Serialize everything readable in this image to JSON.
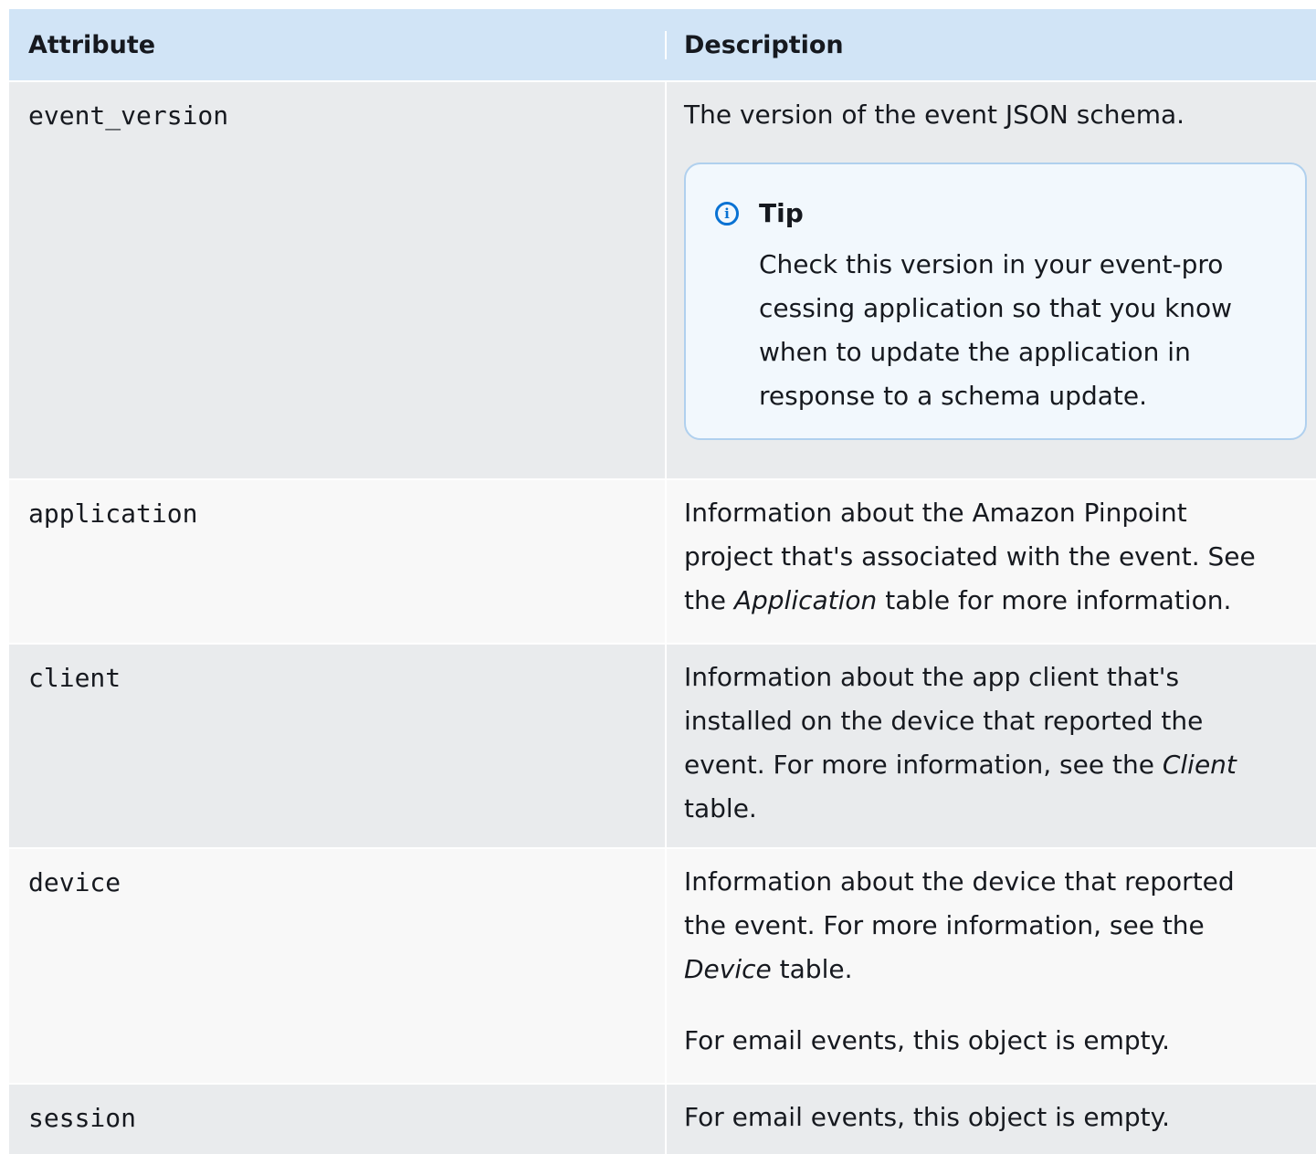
{
  "table": {
    "header": {
      "attribute": "Attribute",
      "description": "Description"
    },
    "rows": [
      {
        "attribute": "event_version",
        "description": "The version of the event JSON schema.",
        "tip": {
          "title": "Tip",
          "lines": [
            "Check this version in your event-pro",
            "cessing application so that you know",
            "when to update the application in",
            "response to a schema update."
          ]
        }
      },
      {
        "attribute": "application",
        "desc_lines": [
          "Information about the Amazon Pinpoint",
          "project that's associated with the event. See"
        ],
        "desc_tail_pre": "the ",
        "desc_tail_em": "Application",
        "desc_tail_post": " table for more information."
      },
      {
        "attribute": "client",
        "desc_lines": [
          "Information about the app client that's",
          "installed on the device that reported the"
        ],
        "desc_mid_pre": "event. For more information, see the ",
        "desc_mid_em": "Client",
        "desc_last": "table."
      },
      {
        "attribute": "device",
        "desc_lines": [
          "Information about the device that reported",
          "the event. For more information, see the"
        ],
        "desc_em": "Device",
        "desc_em_post": " table.",
        "desc_extra": "For email events, this object is empty."
      },
      {
        "attribute": "session",
        "description": "For email events, this object is empty."
      }
    ]
  }
}
